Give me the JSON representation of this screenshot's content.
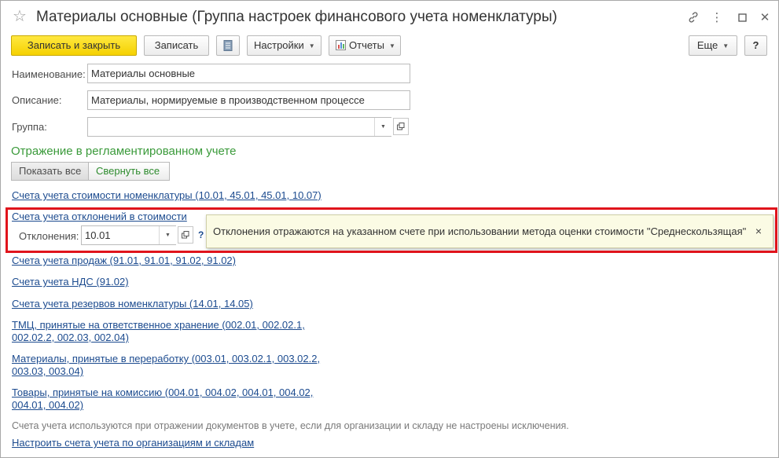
{
  "window": {
    "title": "Материалы основные (Группа настроек финансового учета номенклатуры)",
    "star_icon": "☆",
    "controls": {
      "link": "link-icon",
      "more": "⋮",
      "maximize": "☐",
      "close": "✕"
    }
  },
  "toolbar": {
    "save_close_label": "Записать и закрыть",
    "save_label": "Записать",
    "settings_label": "Настройки",
    "reports_label": "Отчеты",
    "more_label": "Еще",
    "help_label": "?"
  },
  "form": {
    "name_label": "Наименование:",
    "name_value": "Материалы основные",
    "description_label": "Описание:",
    "description_value": "Материалы, нормируемые в производственном процессе",
    "group_label": "Группа:",
    "group_value": ""
  },
  "section": {
    "title": "Отражение в регламентированном учете",
    "show_all_label": "Показать все",
    "collapse_all_label": "Свернуть все"
  },
  "links": {
    "cost_accounts": "Счета учета стоимости номенклатуры (10.01, 45.01, 45.01, 10.07)",
    "deviation_accounts": "Счета учета отклонений в стоимости",
    "sales_accounts": "Счета учета продаж (91.01, 91.01, 91.02, 91.02)",
    "vat_accounts": "Счета учета НДС (91.02)",
    "reserve_accounts": "Счета учета резервов номенклатуры (14.01, 14.05)",
    "custody_line1": "ТМЦ, принятые на ответственное хранение (002.01, 002.02.1,",
    "custody_line2": "002.02.2, 002.03, 002.04)",
    "processing_line1": "Материалы, принятые в переработку (003.01, 003.02.1, 003.02.2,",
    "processing_line2": "003.03, 003.04)",
    "commission_line1": "Товары, принятые на комиссию (004.01, 004.02, 004.01, 004.02,",
    "commission_line2": "004.01, 004.02)",
    "configure": "Настроить счета учета по организациям и складам"
  },
  "deviation": {
    "label": "Отклонения:",
    "value": "10.01",
    "help": "?"
  },
  "tooltip": {
    "text": "Отклонения отражаются на указанном счете при использовании метода оценки стоимости \"Среднескользящая\"",
    "close": "×"
  },
  "note": "Счета учета используются при отражении документов в учете, если для организации и складу не настроены исключения.",
  "colors": {
    "primary_button": "#f5d100",
    "section_title": "#3a9a3a",
    "link": "#1c4b8f",
    "highlight": "#e0141c",
    "tooltip_bg": "#fbfbe4"
  }
}
